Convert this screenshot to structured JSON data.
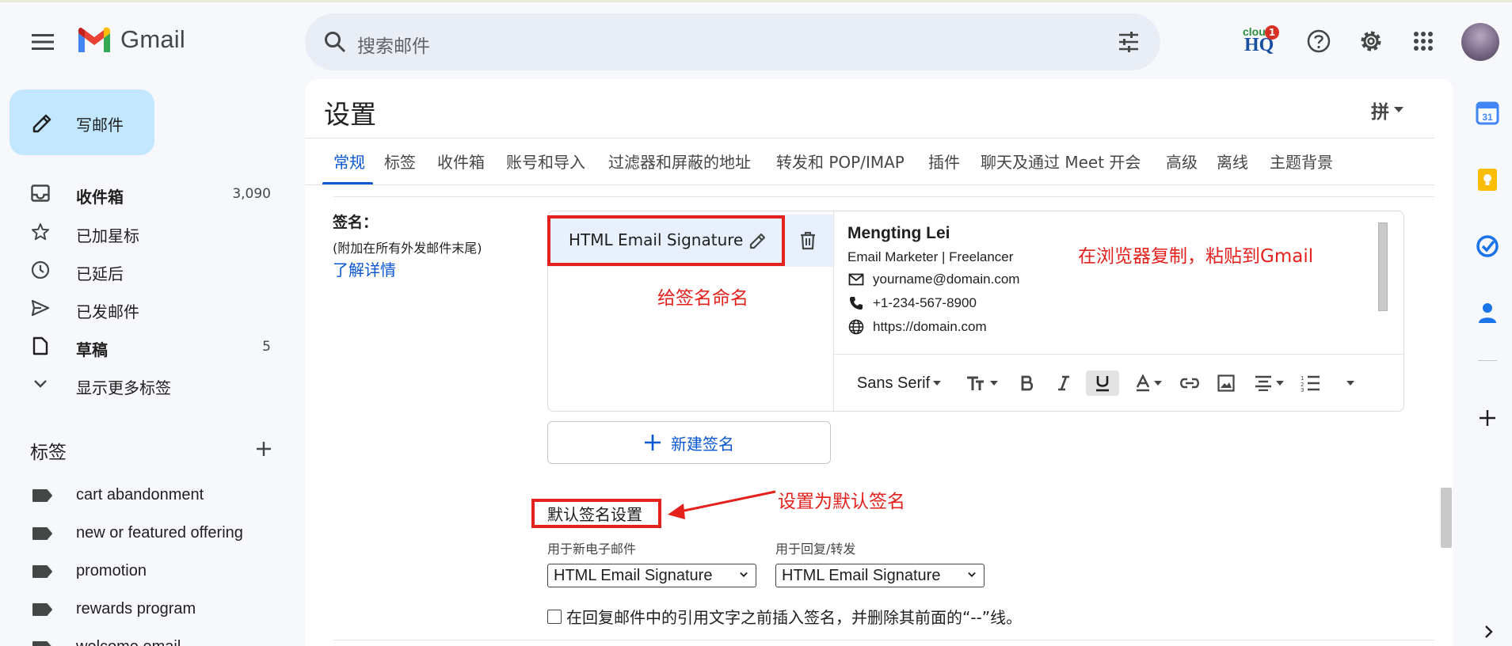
{
  "app": {
    "name": "Gmail"
  },
  "search": {
    "placeholder": "搜索邮件"
  },
  "compose": {
    "label": "写邮件"
  },
  "nav": [
    {
      "label": "收件箱",
      "count": "3,090",
      "bold": true
    },
    {
      "label": "已加星标",
      "count": ""
    },
    {
      "label": "已延后",
      "count": ""
    },
    {
      "label": "已发邮件",
      "count": ""
    },
    {
      "label": "草稿",
      "count": "5",
      "bold": true
    },
    {
      "label": "显示更多标签",
      "count": ""
    }
  ],
  "labels": {
    "title": "标签",
    "items": [
      "cart abandonment",
      "new or featured offering",
      "promotion",
      "rewards program",
      "welcome email"
    ]
  },
  "cloudhq": {
    "text_top": "clou",
    "text_main": "HQ",
    "badge": "1"
  },
  "main": {
    "title": "设置",
    "ime": "拼",
    "tabs": [
      "常规",
      "标签",
      "收件箱",
      "账号和导入",
      "过滤器和屏蔽的地址",
      "转发和 POP/IMAP",
      "插件",
      "聊天及通过 Meet 开会",
      "高级",
      "离线",
      "主题背景"
    ],
    "active_tab": "常规"
  },
  "signature": {
    "heading": "签名：",
    "subheading": "(附加在所有外发邮件末尾)",
    "learn_more": "了解详情",
    "items": [
      {
        "name": "HTML Email Signature"
      }
    ],
    "editor": {
      "name": "Mengting Lei",
      "role": "Email Marketer | Freelancer",
      "email": "yourname@domain.com",
      "phone": "+1-234-567-8900",
      "website": "https://domain.com"
    },
    "toolbar": {
      "font": "Sans Serif"
    },
    "new_button": "新建签名"
  },
  "defaults": {
    "title": "默认签名设置",
    "new_mail_label": "用于新电子邮件",
    "reply_label": "用于回复/转发",
    "new_mail_value": "HTML Email Signature",
    "reply_value": "HTML Email Signature",
    "checkbox_label": "在回复邮件中的引用文字之前插入签名，并删除其前面的“--”线。"
  },
  "annotations": {
    "name_it": "给签名命名",
    "paste": "在浏览器复制，粘贴到Gmail",
    "set_default": "设置为默认签名",
    "color": "#e5211d"
  },
  "colors": {
    "accent": "#0b57d0",
    "compose_bg": "#c2e7ff",
    "search_bg": "#e9eef6",
    "page_bg": "#f6f8fc"
  }
}
